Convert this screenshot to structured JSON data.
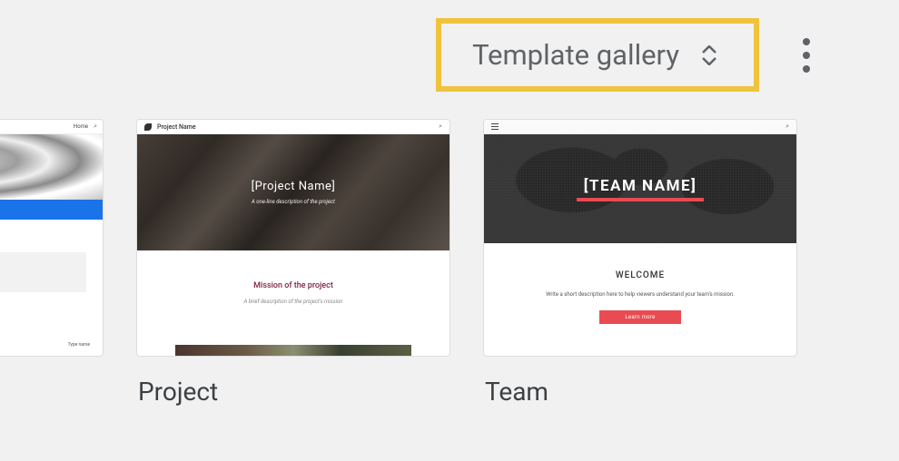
{
  "header": {
    "gallery_label": "Template gallery"
  },
  "templates": [
    {
      "label": "Project",
      "preview": {
        "nav_title": "Project Name",
        "hero_title": "[Project Name]",
        "hero_sub": "A one-line description of the project",
        "section_title": "Mission of the project",
        "section_desc": "A brief description of the project's mission"
      }
    },
    {
      "label": "Team",
      "preview": {
        "hero_title": "[TEAM NAME]",
        "section_title": "WELCOME",
        "section_desc": "Write a short description here to help viewers understand your team's mission.",
        "cta": "Learn more"
      }
    }
  ],
  "partial": {
    "nav_right": "Home",
    "bottom_right": "Type name"
  }
}
